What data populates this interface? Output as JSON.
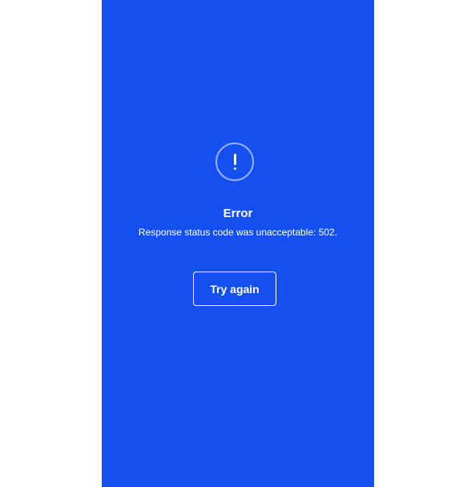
{
  "colors": {
    "background": "#1450f0",
    "foreground": "#ffffff"
  },
  "icon": {
    "name": "exclamation-circle-icon"
  },
  "error": {
    "title": "Error",
    "message": "Response status code was unacceptable: 502."
  },
  "actions": {
    "try_again_label": "Try again"
  }
}
